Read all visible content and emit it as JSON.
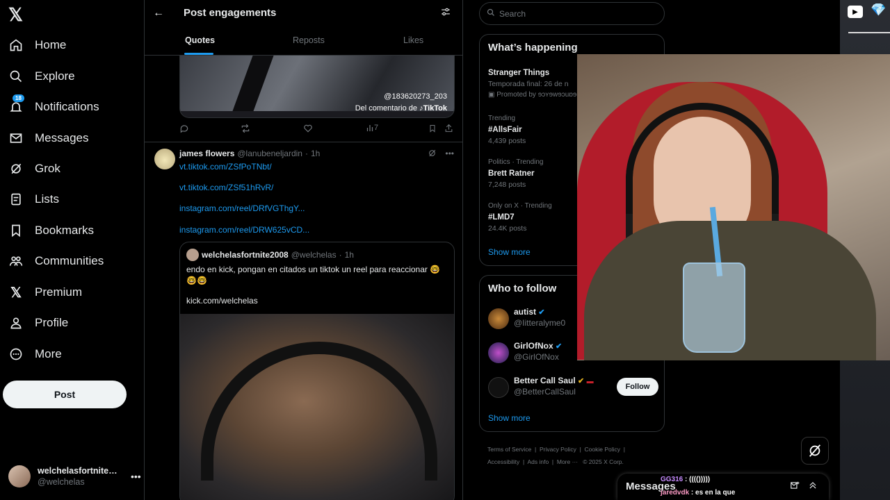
{
  "nav": {
    "items": [
      {
        "label": "Home",
        "icon": "home-icon"
      },
      {
        "label": "Explore",
        "icon": "search-icon"
      },
      {
        "label": "Notifications",
        "icon": "bell-icon",
        "badge": "18"
      },
      {
        "label": "Messages",
        "icon": "envelope-icon"
      },
      {
        "label": "Grok",
        "icon": "grok-icon"
      },
      {
        "label": "Lists",
        "icon": "list-icon"
      },
      {
        "label": "Bookmarks",
        "icon": "bookmark-icon"
      },
      {
        "label": "Communities",
        "icon": "people-icon"
      },
      {
        "label": "Premium",
        "icon": "x-logo-icon"
      },
      {
        "label": "Profile",
        "icon": "person-icon"
      },
      {
        "label": "More",
        "icon": "more-circle-icon"
      }
    ],
    "post_button": "Post",
    "account": {
      "name": "welchelasfortnite2...",
      "handle": "@welchelas"
    }
  },
  "header": {
    "title": "Post engagements",
    "tabs": [
      "Quotes",
      "Reposts",
      "Likes"
    ],
    "active_tab": "Quotes"
  },
  "first_post": {
    "tiktok_handle": "@183620273_203",
    "tiktok_credit": "Del comentario de",
    "tiktok_brand": "TikTok",
    "views": "7"
  },
  "post": {
    "name": "james flowers",
    "handle": "@lanubeneljardin",
    "time": "1h",
    "links": [
      "vt.tiktok.com/ZSfPoTNbt/",
      "vt.tiktok.com/ZSf51hRvR/",
      "instagram.com/reel/DRfVGThgY...",
      "instagram.com/reel/DRW625vCD..."
    ],
    "quote": {
      "name": "welchelasfortnite2008",
      "handle": "@welchelas",
      "time": "1h",
      "text": "endo en kick, pongan en citados un tiktok un reel para reaccionar 🤓🤓🤓",
      "link": "kick.com/welchelas"
    }
  },
  "search": {
    "placeholder": "Search"
  },
  "happening": {
    "title": "What’s happening",
    "trends": [
      {
        "meta": "",
        "name": "Stranger Things",
        "sub": "Temporada final: 26 de n",
        "promo": "Promoted by ɘɔʏɘwɘɔuɒɘ"
      },
      {
        "meta": "Trending",
        "name": "#AllsFair",
        "sub": "4,439 posts"
      },
      {
        "meta": "Politics · Trending",
        "name": "Brett Ratner",
        "sub": "7,248 posts"
      },
      {
        "meta": "Only on X · Trending",
        "name": "#LMD7",
        "sub": "24.4K posts"
      }
    ],
    "show_more": "Show more"
  },
  "who_to_follow": {
    "title": "Who to follow",
    "users": [
      {
        "name": "autist",
        "handle": "@Iitteralyme0"
      },
      {
        "name": "GirlOfNox",
        "handle": "@GirlOfNox"
      },
      {
        "name": "Better Call Saul",
        "handle": "@BetterCallSaul"
      }
    ],
    "follow_label": "Follow",
    "show_more": "Show more"
  },
  "footer": {
    "links": [
      "Terms of Service",
      "Privacy Policy",
      "Cookie Policy",
      "Accessibility",
      "Ads info",
      "More ···",
      "© 2025 X Corp."
    ]
  },
  "messages": {
    "title": "Messages"
  },
  "chat": [
    {
      "user": "GG316",
      "text": "(((()))))"
    },
    {
      "user": "jaredvdk",
      "text": "es en la que"
    }
  ],
  "colors": {
    "accent": "#1d9bf0",
    "bg": "#000000",
    "border": "#2f3336",
    "muted": "#71767b"
  }
}
